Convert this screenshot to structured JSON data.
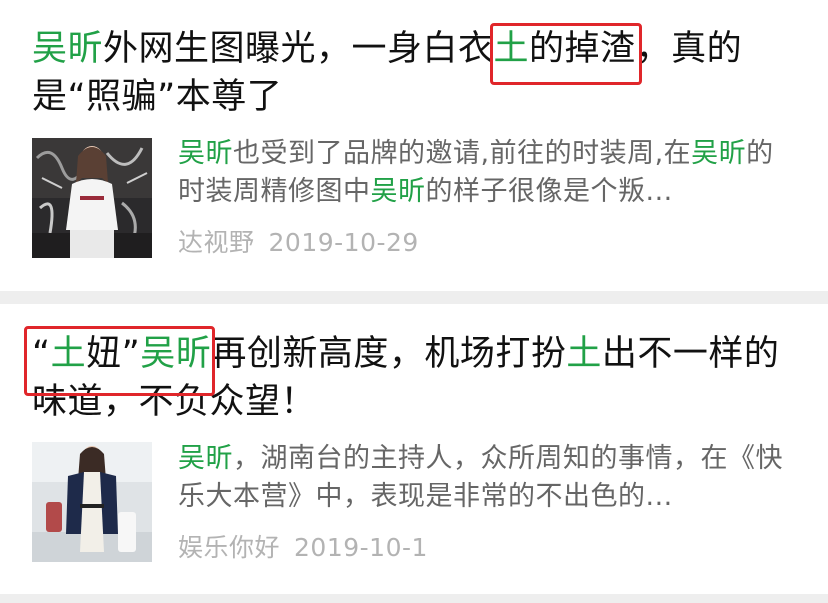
{
  "articles": [
    {
      "title": {
        "name": "吴昕",
        "part1": "外网生图曝光，一身白衣",
        "keyword": "土",
        "part2": "的掉渣",
        "part3": "，真的是“照骗”本尊了"
      },
      "snippet": {
        "name1": "吴昕",
        "part1": "也受到了品牌的邀请,前往的时装周,在",
        "name2": "吴昕",
        "part2": "的时装周精修图中",
        "name3": "吴昕",
        "part3": "的样子很像是个叛..."
      },
      "source": "达视野",
      "date": "2019-10-29",
      "thumbnail": "woman-in-white-street-photo"
    },
    {
      "title": {
        "quote_open": "“",
        "keyword": "土",
        "mid": "妞”",
        "name": "吴昕",
        "part1": "再创新高度，机场打扮",
        "keyword2": "土",
        "part2": "出不一样的味道，不负众望！"
      },
      "snippet": {
        "name1": "吴昕",
        "part1": "，湖南台的主持人，众所周知的事情，在《快乐大本营》中，表现是非常的不出色的..."
      },
      "source": "娱乐你好",
      "date": "2019-10-1",
      "thumbnail": "woman-airport-outfit-photo"
    }
  ],
  "colors": {
    "highlight": "#21a147",
    "annotation_box": "#e0262a",
    "separator": "#eeeeee"
  }
}
